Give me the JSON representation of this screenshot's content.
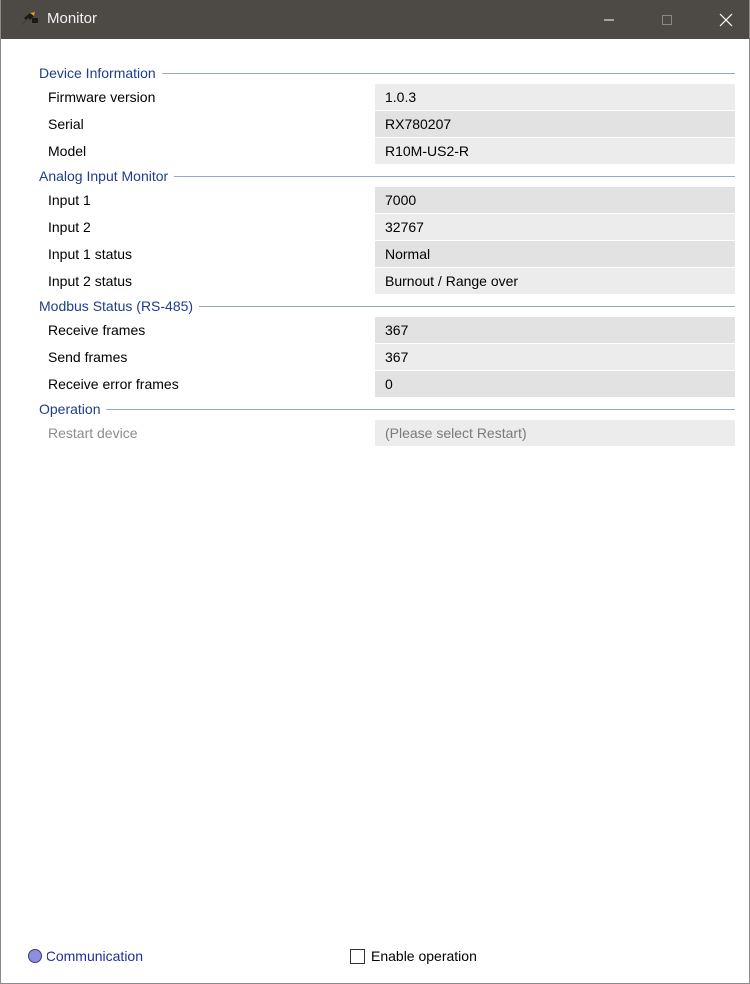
{
  "window": {
    "title": "Monitor",
    "icon": "plug-device-icon"
  },
  "groups": [
    {
      "title": "Device Information",
      "rows": [
        {
          "label": "Firmware version",
          "value": "1.0.3"
        },
        {
          "label": "Serial",
          "value": "RX780207"
        },
        {
          "label": "Model",
          "value": "R10M-US2-R"
        }
      ]
    },
    {
      "title": "Analog Input Monitor",
      "rows": [
        {
          "label": "Input 1",
          "value": "7000"
        },
        {
          "label": "Input 2",
          "value": "32767"
        },
        {
          "label": "Input 1 status",
          "value": "Normal"
        },
        {
          "label": "Input 2 status",
          "value": "Burnout / Range over"
        }
      ]
    },
    {
      "title": "Modbus Status (RS-485)",
      "rows": [
        {
          "label": "Receive frames",
          "value": "367"
        },
        {
          "label": "Send frames",
          "value": "367"
        },
        {
          "label": "Receive error frames",
          "value": "0"
        }
      ]
    },
    {
      "title": "Operation",
      "rows": [
        {
          "label": "Restart device",
          "value": "(Please select Restart)"
        }
      ]
    }
  ],
  "status": {
    "indicator_color": "#8e8ee0",
    "text": "Communication"
  },
  "enable_operation": {
    "label": "Enable operation",
    "checked": false
  },
  "colors": {
    "titlebar": "#4d4a46",
    "group_title": "#1e3d8c",
    "status_text": "#1e2e9e"
  }
}
